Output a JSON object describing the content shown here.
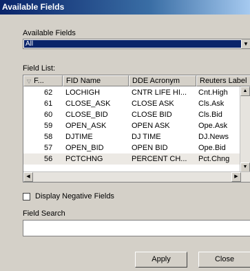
{
  "window": {
    "title": "Available Fields"
  },
  "available_fields": {
    "label": "Available Fields",
    "selected": "All"
  },
  "field_list": {
    "label": "Field List:",
    "columns": [
      "F...",
      "FID Name",
      "DDE Acronym",
      "Reuters Label"
    ],
    "rows": [
      {
        "fid": "62",
        "name": "LOCHIGH",
        "dde": "CNTR LIFE HI...",
        "label": "Cnt.High"
      },
      {
        "fid": "61",
        "name": "CLOSE_ASK",
        "dde": "CLOSE ASK",
        "label": "Cls.Ask"
      },
      {
        "fid": "60",
        "name": "CLOSE_BID",
        "dde": "CLOSE BID",
        "label": "Cls.Bid"
      },
      {
        "fid": "59",
        "name": "OPEN_ASK",
        "dde": "OPEN ASK",
        "label": "Ope.Ask"
      },
      {
        "fid": "58",
        "name": "DJTIME",
        "dde": "DJ TIME",
        "label": "DJ.News"
      },
      {
        "fid": "57",
        "name": "OPEN_BID",
        "dde": "OPEN BID",
        "label": "Ope.Bid"
      },
      {
        "fid": "56",
        "name": "PCTCHNG",
        "dde": "PERCENT CH...",
        "label": "Pct.Chng"
      }
    ]
  },
  "display_negative": {
    "label": "Display Negative Fields",
    "checked": false
  },
  "field_search": {
    "label": "Field Search",
    "value": ""
  },
  "buttons": {
    "apply": "Apply",
    "close": "Close"
  }
}
